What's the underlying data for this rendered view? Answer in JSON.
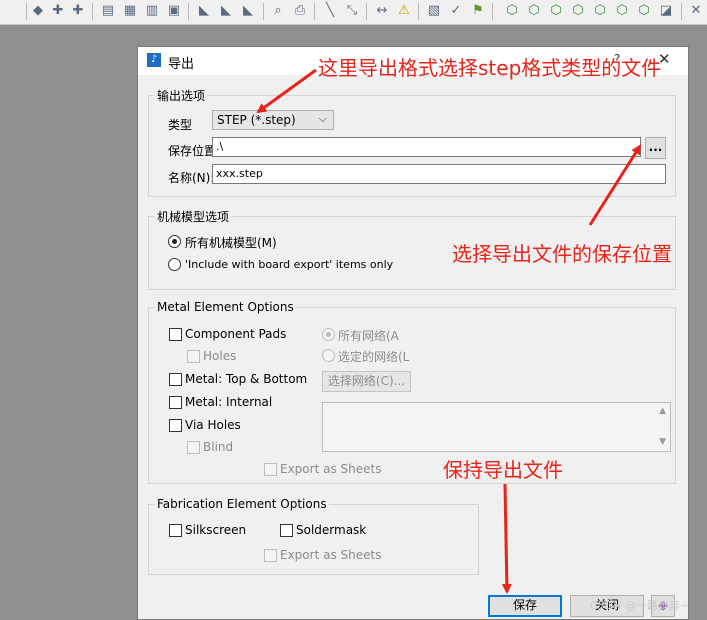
{
  "toolbar": {
    "icons": [
      "pin-icon",
      "snap-icon",
      "snap2-icon",
      "properties-icon",
      "layers-icon",
      "materials-icon",
      "library-icon",
      "route-icon",
      "route2-icon",
      "route3-icon",
      "find-icon",
      "print-icon",
      "ruler-icon",
      "measure-icon",
      "dimension-icon",
      "warning-icon",
      "report-icon",
      "verify-icon",
      "flag-icon",
      "view-iso-icon",
      "view-front-icon",
      "view-back-icon",
      "view-top-icon",
      "view-bottom-icon",
      "view-left-icon",
      "view-right-icon",
      "view-3d-icon"
    ]
  },
  "dialog": {
    "title": "导出",
    "help": "?",
    "close": "✕",
    "export_options": {
      "legend": "输出选项",
      "type_label": "类型",
      "type_value": "STEP (*.step)",
      "location_label": "保存位置",
      "location_value": ".\\",
      "browse_label": "...",
      "name_label": "名称(N):",
      "name_value": "xxx.step"
    },
    "mech_options": {
      "legend": "机械模型选项",
      "all_models": "所有机械模型(M)",
      "include_items": "'Include with board export' items only"
    },
    "metal_options": {
      "legend": "Metal Element Options",
      "component_pads": "Component Pads",
      "holes": "Holes",
      "metal_top_bottom": "Metal: Top & Bottom",
      "metal_internal": "Metal: Internal",
      "via_holes": "Via Holes",
      "blind": "Blind",
      "all_nets": "所有网络(A",
      "selected_nets": "选定的网络(L",
      "select_nets_button": "选择网络(C)...",
      "export_as_sheets": "Export as Sheets"
    },
    "fab_options": {
      "legend": "Fabrication Element Options",
      "silkscreen": "Silkscreen",
      "soldermask": "Soldermask",
      "export_as_sheets": "Export as Sheets"
    },
    "save_button": "保存",
    "close_button": "关闭"
  },
  "annotations": {
    "format_note": "这里导出格式选择step格式类型的文件",
    "location_note": "选择导出文件的保存位置",
    "save_note": "保持导出文件"
  },
  "watermark": "CSDN @一路奔奔~",
  "colors": {
    "annotation": "#e8241a",
    "accent": "#0078d7"
  }
}
